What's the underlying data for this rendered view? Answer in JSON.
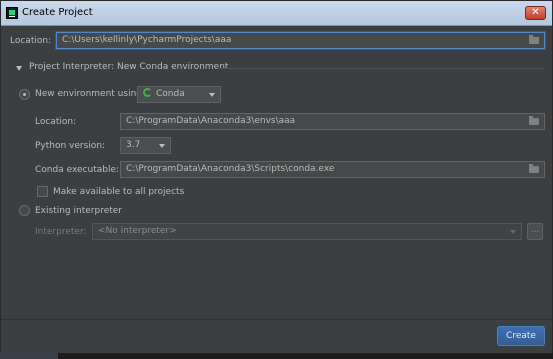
{
  "window": {
    "title": "Create Project",
    "close_glyph": "✕"
  },
  "location": {
    "label": "Location:",
    "value": "C:\\Users\\kellinly\\PycharmProjects\\aaa"
  },
  "interpreter_section": {
    "title": "Project Interpreter: New Conda environment"
  },
  "new_env": {
    "radio_label": "New environment using",
    "tool_selected": "Conda",
    "location_label": "Location:",
    "location_value": "C:\\ProgramData\\Anaconda3\\envs\\aaa",
    "python_label": "Python version:",
    "python_value": "3.7",
    "conda_label": "Conda executable:",
    "conda_value": "C:\\ProgramData\\Anaconda3\\Scripts\\conda.exe",
    "make_available_label": "Make available to all projects"
  },
  "existing": {
    "radio_label": "Existing interpreter",
    "interpreter_label": "Interpreter:",
    "interpreter_value": "<No interpreter>",
    "more_button": "..."
  },
  "footer": {
    "create_label": "Create"
  },
  "icons": {
    "app": "pycharm-icon",
    "folder": "folder-icon",
    "conda": "conda-icon"
  },
  "colors": {
    "background": "#3c3f41",
    "focus_border": "#4f88c8",
    "primary_button": "#365e95",
    "conda_green": "#43b049"
  }
}
